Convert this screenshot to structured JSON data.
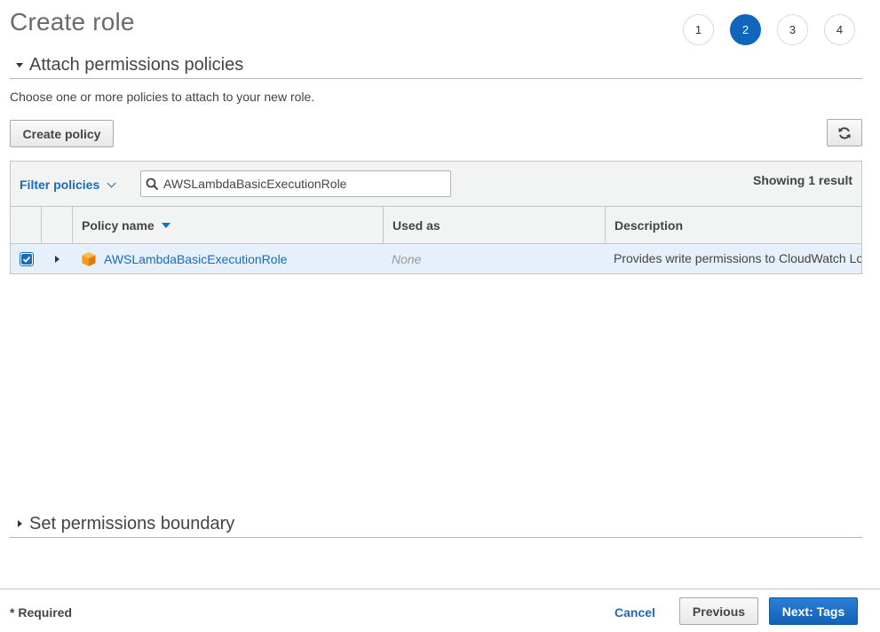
{
  "page": {
    "title": "Create role",
    "steps": [
      "1",
      "2",
      "3",
      "4"
    ],
    "active_step": "2"
  },
  "attach_section": {
    "title": "Attach permissions policies",
    "description": "Choose one or more policies to attach to your new role.",
    "create_policy_label": "Create policy",
    "refresh_icon": "refresh-icon"
  },
  "table": {
    "filter_label": "Filter policies",
    "search": {
      "value": "AWSLambdaBasicExecutionRole",
      "placeholder": ""
    },
    "showing": "Showing 1 result",
    "columns": [
      "Policy name",
      "Used as",
      "Description"
    ],
    "rows": [
      {
        "checked": true,
        "name": "AWSLambdaBasicExecutionRole",
        "used_as": "None",
        "description": "Provides write permissions to CloudWatch Logs.",
        "icon": "aws-managed-policy-icon"
      }
    ]
  },
  "boundary_section": {
    "title": "Set permissions boundary"
  },
  "footer": {
    "required": "* Required",
    "cancel": "Cancel",
    "previous": "Previous",
    "next": "Next: Tags"
  },
  "colors": {
    "accent": "#1a6bb8",
    "active_step": "#1166bb",
    "selected_row": "#e6f0fb",
    "policy_icon": "#f59b1c"
  }
}
